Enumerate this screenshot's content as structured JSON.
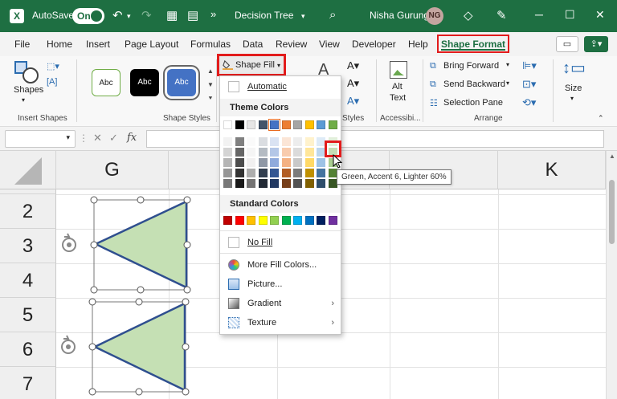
{
  "titlebar": {
    "autosave_label": "AutoSave",
    "autosave_state": "On",
    "doc_title": "Decision Tree",
    "user_name": "Nisha Gurung",
    "user_initials": "NG",
    "accent": "#1e6f42"
  },
  "menu": {
    "tabs": [
      "File",
      "Home",
      "Insert",
      "Page Layout",
      "Formulas",
      "Data",
      "Review",
      "View",
      "Developer",
      "Help"
    ],
    "active_tab": "Shape Format"
  },
  "ribbon": {
    "insert_shapes": {
      "shapes_label": "Shapes",
      "group_label": "Insert Shapes"
    },
    "shape_styles": {
      "samples": [
        "Abc",
        "Abc",
        "Abc"
      ],
      "group_label": "Shape Styles",
      "shape_fill_label": "Shape Fill"
    },
    "wordart_group_label": "Styles",
    "accessibility": {
      "alt_text_line1": "Alt",
      "alt_text_line2": "Text",
      "group_label": "Accessibi..."
    },
    "arrange": {
      "bring_forward": "Bring Forward",
      "send_backward": "Send Backward",
      "selection_pane": "Selection Pane",
      "group_label": "Arrange"
    },
    "size": {
      "label": "Size"
    }
  },
  "formula_bar": {
    "fx": "fx"
  },
  "grid": {
    "columns": [
      "G",
      "K"
    ],
    "rows": [
      "2",
      "3",
      "4",
      "5",
      "6",
      "7"
    ]
  },
  "shape_fill_menu": {
    "automatic": "Automatic",
    "theme_colors_header": "Theme Colors",
    "theme_colors": [
      "#ffffff",
      "#000000",
      "#e7e6e6",
      "#44546a",
      "#4472c4",
      "#ed7d31",
      "#a5a5a5",
      "#ffc000",
      "#5b9bd5",
      "#70ad47"
    ],
    "standard_colors_header": "Standard Colors",
    "standard_colors": [
      "#c00000",
      "#ff0000",
      "#ffc000",
      "#ffff00",
      "#92d050",
      "#00b050",
      "#00b0f0",
      "#0070c0",
      "#002060",
      "#7030a0"
    ],
    "no_fill": "No Fill",
    "more_fill_colors": "More Fill Colors...",
    "picture": "Picture...",
    "gradient": "Gradient",
    "texture": "Texture",
    "tooltip": "Green, Accent 6, Lighter 60%"
  },
  "shape_fill_color": "#c5e0b4",
  "shape_outline_color": "#2f4f8f"
}
